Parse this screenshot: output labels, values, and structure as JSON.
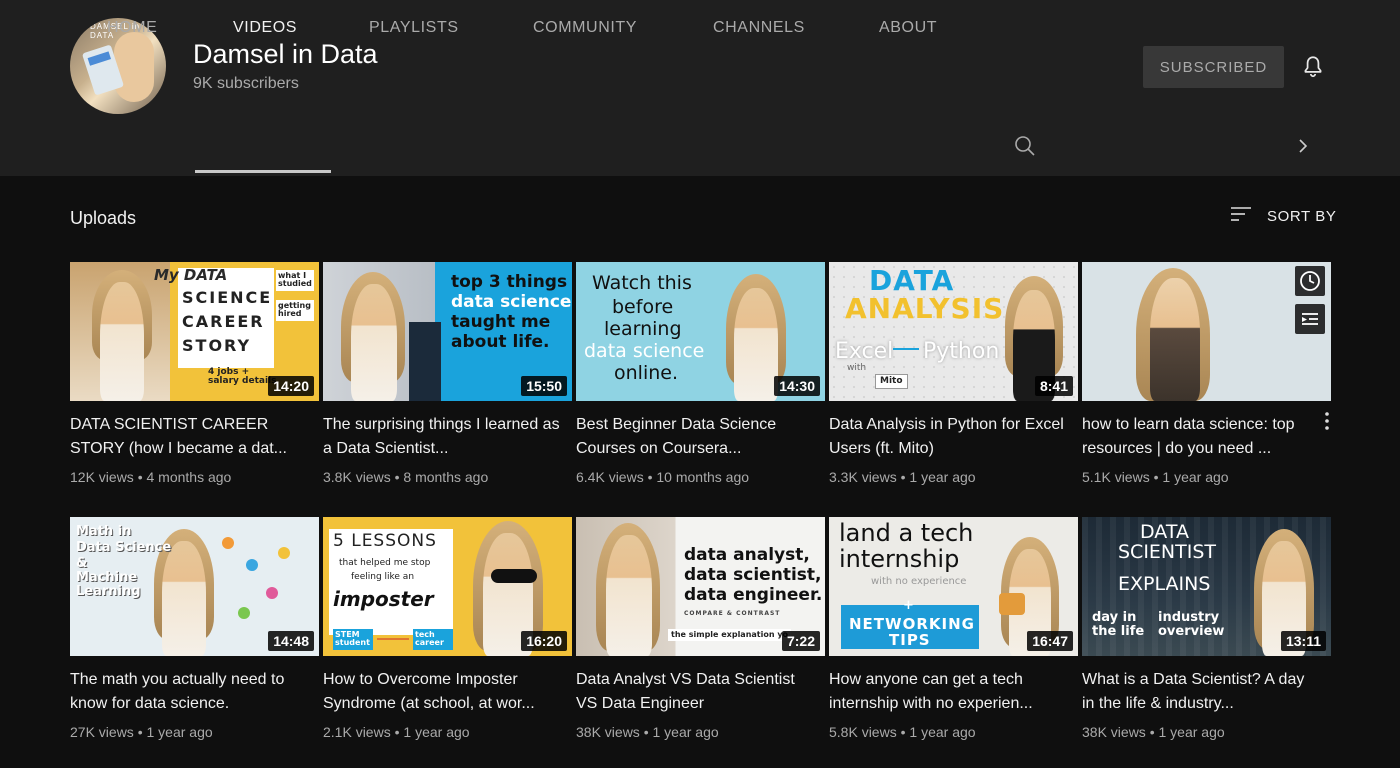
{
  "channel": {
    "name": "Damsel in Data",
    "subscribers": "9K subscribers",
    "avatar_text": "DAMSEL in DATA"
  },
  "header": {
    "subscribe_label": "SUBSCRIBED"
  },
  "tabs": [
    {
      "label": "HOME"
    },
    {
      "label": "VIDEOS"
    },
    {
      "label": "PLAYLISTS"
    },
    {
      "label": "COMMUNITY"
    },
    {
      "label": "CHANNELS"
    },
    {
      "label": "ABOUT"
    }
  ],
  "section": {
    "title": "Uploads",
    "sort_label": "SORT BY"
  },
  "videos": [
    {
      "title": "DATA SCIENTIST CAREER STORY (how I became a dat...",
      "views": "12K views",
      "age": "4 months ago",
      "duration": "14:20",
      "thumb_text": [
        "My DATA",
        "SCIENCE",
        "CAREER",
        "STORY",
        "what I studied",
        "getting hired",
        "4 jobs + salary details"
      ]
    },
    {
      "title": "The surprising things I learned as a Data Scientist...",
      "views": "3.8K views",
      "age": "8 months ago",
      "duration": "15:50",
      "thumb_text": [
        "top 3 things",
        "data science",
        "taught me",
        "about life."
      ]
    },
    {
      "title": "Best Beginner Data Science Courses on Coursera...",
      "views": "6.4K views",
      "age": "10 months ago",
      "duration": "14:30",
      "thumb_text": [
        "Watch this",
        "before",
        "learning",
        "data science",
        "online."
      ]
    },
    {
      "title": "Data Analysis in Python for Excel Users (ft. Mito)",
      "views": "3.3K views",
      "age": "1 year ago",
      "duration": "8:41",
      "thumb_text": [
        "DATA",
        "ANALYSIS",
        "Excel",
        "Python",
        "with",
        "Mito"
      ]
    },
    {
      "title": "how to learn data science: top resources | do you need ...",
      "views": "5.1K views",
      "age": "1 year ago",
      "duration": "",
      "thumb_text": []
    },
    {
      "title": "The math you actually need to know for data science.",
      "views": "27K views",
      "age": "1 year ago",
      "duration": "14:48",
      "thumb_text": [
        "Math in",
        "Data Science",
        "&",
        "Machine",
        "Learning"
      ]
    },
    {
      "title": "How to Overcome Imposter Syndrome (at school, at wor...",
      "views": "2.1K views",
      "age": "1 year ago",
      "duration": "16:20",
      "thumb_text": [
        "5 LESSONS",
        "that helped me stop",
        "feeling like an",
        "imposter",
        "STEM student",
        "tech career"
      ]
    },
    {
      "title": "Data Analyst VS Data Scientist VS Data Engineer",
      "views": "38K views",
      "age": "1 year ago",
      "duration": "7:22",
      "thumb_text": [
        "data analyst,",
        "data scientist,",
        "data engineer.",
        "COMPARE & CONTRAST",
        "the simple explanation yo"
      ]
    },
    {
      "title": "How anyone can get a tech internship with no experien...",
      "views": "5.8K views",
      "age": "1 year ago",
      "duration": "16:47",
      "thumb_text": [
        "land a tech",
        "internship",
        "with no experience",
        "+",
        "NETWORKING",
        "TIPS"
      ]
    },
    {
      "title": "What is a Data Scientist? A day in the life & industry...",
      "views": "38K views",
      "age": "1 year ago",
      "duration": "13:11",
      "thumb_text": [
        "DATA",
        "SCIENTIST",
        "EXPLAINS",
        "day in the life",
        "industry overview"
      ]
    }
  ],
  "colors": {
    "background": "#0f0f0f",
    "header_bg": "#1f1f1f",
    "text_secondary": "#aaaaaa",
    "thumb1_bg": "#f2c23a",
    "thumb2_accent": "#1aa3dc",
    "thumb3_bg": "#8fd3e3",
    "thumb4_accent": "#f2c12e",
    "thumb7_bg": "#f2c23a",
    "thumb9_accent": "#1e9bd7"
  }
}
